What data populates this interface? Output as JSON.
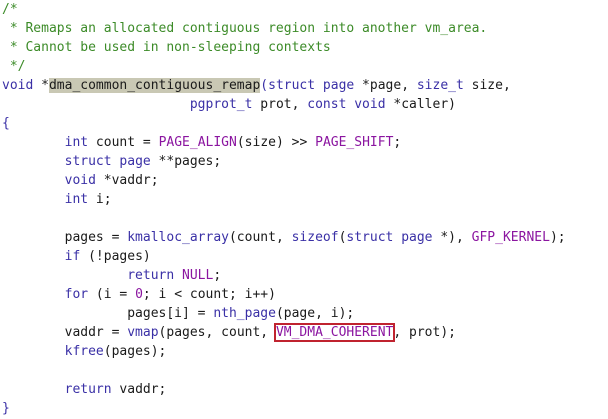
{
  "editor": {
    "lines": [
      {
        "segments": [
          {
            "text": "/*",
            "c": "cm"
          }
        ]
      },
      {
        "segments": [
          {
            "text": " * Remaps an allocated contiguous region into another vm_area.",
            "c": "cm"
          }
        ]
      },
      {
        "segments": [
          {
            "text": " * Cannot be used in non-sleeping contexts",
            "c": "cm"
          }
        ]
      },
      {
        "segments": [
          {
            "text": " */",
            "c": "cm"
          }
        ]
      },
      {
        "segments": [
          {
            "text": "void",
            "c": "ty"
          },
          {
            "text": " *",
            "c": ""
          },
          {
            "text": "dma_common_contiguous_remap",
            "c": "hl"
          },
          {
            "text": "(",
            "c": "pu"
          },
          {
            "text": "struct",
            "c": "kw"
          },
          {
            "text": " ",
            "c": ""
          },
          {
            "text": "page",
            "c": "ty"
          },
          {
            "text": " *page, ",
            "c": ""
          },
          {
            "text": "size_t",
            "c": "ty"
          },
          {
            "text": " size,",
            "c": ""
          }
        ]
      },
      {
        "segments": [
          {
            "text": "                        ",
            "c": ""
          },
          {
            "text": "pgprot_t",
            "c": "ty"
          },
          {
            "text": " prot, ",
            "c": ""
          },
          {
            "text": "const",
            "c": "kw"
          },
          {
            "text": " ",
            "c": ""
          },
          {
            "text": "void",
            "c": "ty"
          },
          {
            "text": " *caller)",
            "c": ""
          }
        ]
      },
      {
        "segments": [
          {
            "text": "{",
            "c": "pu"
          }
        ]
      },
      {
        "segments": [
          {
            "text": "        ",
            "c": ""
          },
          {
            "text": "int",
            "c": "ty"
          },
          {
            "text": " count = ",
            "c": ""
          },
          {
            "text": "PAGE_ALIGN",
            "c": "mc"
          },
          {
            "text": "(size) >> ",
            "c": ""
          },
          {
            "text": "PAGE_SHIFT",
            "c": "mc"
          },
          {
            "text": ";",
            "c": ""
          }
        ]
      },
      {
        "segments": [
          {
            "text": "        ",
            "c": ""
          },
          {
            "text": "struct",
            "c": "kw"
          },
          {
            "text": " ",
            "c": ""
          },
          {
            "text": "page",
            "c": "ty"
          },
          {
            "text": " **pages;",
            "c": ""
          }
        ]
      },
      {
        "segments": [
          {
            "text": "        ",
            "c": ""
          },
          {
            "text": "void",
            "c": "ty"
          },
          {
            "text": " *vaddr;",
            "c": ""
          }
        ]
      },
      {
        "segments": [
          {
            "text": "        ",
            "c": ""
          },
          {
            "text": "int",
            "c": "ty"
          },
          {
            "text": " i;",
            "c": ""
          }
        ]
      },
      {
        "segments": [
          {
            "text": "",
            "c": ""
          }
        ]
      },
      {
        "segments": [
          {
            "text": "        pages = ",
            "c": ""
          },
          {
            "text": "kmalloc_array",
            "c": "fn"
          },
          {
            "text": "(count, ",
            "c": ""
          },
          {
            "text": "sizeof",
            "c": "kw"
          },
          {
            "text": "(",
            "c": ""
          },
          {
            "text": "struct",
            "c": "kw"
          },
          {
            "text": " ",
            "c": ""
          },
          {
            "text": "page",
            "c": "ty"
          },
          {
            "text": " *), ",
            "c": ""
          },
          {
            "text": "GFP_KERNEL",
            "c": "mc"
          },
          {
            "text": ");",
            "c": ""
          }
        ]
      },
      {
        "segments": [
          {
            "text": "        ",
            "c": ""
          },
          {
            "text": "if",
            "c": "kw"
          },
          {
            "text": " (!pages)",
            "c": ""
          }
        ]
      },
      {
        "segments": [
          {
            "text": "                ",
            "c": ""
          },
          {
            "text": "return",
            "c": "kw"
          },
          {
            "text": " ",
            "c": ""
          },
          {
            "text": "NULL",
            "c": "mc"
          },
          {
            "text": ";",
            "c": ""
          }
        ]
      },
      {
        "segments": [
          {
            "text": "        ",
            "c": ""
          },
          {
            "text": "for",
            "c": "kw"
          },
          {
            "text": " (i = ",
            "c": ""
          },
          {
            "text": "0",
            "c": "mc"
          },
          {
            "text": "; i < count; i++)",
            "c": ""
          }
        ]
      },
      {
        "segments": [
          {
            "text": "                pages[i] = ",
            "c": ""
          },
          {
            "text": "nth_page",
            "c": "fn"
          },
          {
            "text": "(page, i);",
            "c": ""
          }
        ]
      },
      {
        "segments": [
          {
            "text": "        vaddr = ",
            "c": ""
          },
          {
            "text": "vmap",
            "c": "fn"
          },
          {
            "text": "(pages, count, ",
            "c": ""
          },
          {
            "text": "VM_DMA_COHERENT",
            "c": "mc box"
          },
          {
            "text": ", prot);",
            "c": ""
          }
        ]
      },
      {
        "segments": [
          {
            "text": "        ",
            "c": ""
          },
          {
            "text": "kfree",
            "c": "fn"
          },
          {
            "text": "(pages);",
            "c": ""
          }
        ]
      },
      {
        "segments": [
          {
            "text": "",
            "c": ""
          }
        ]
      },
      {
        "segments": [
          {
            "text": "        ",
            "c": ""
          },
          {
            "text": "return",
            "c": "kw"
          },
          {
            "text": " vaddr;",
            "c": ""
          }
        ]
      },
      {
        "segments": [
          {
            "text": "}",
            "c": "pu"
          }
        ]
      }
    ]
  }
}
